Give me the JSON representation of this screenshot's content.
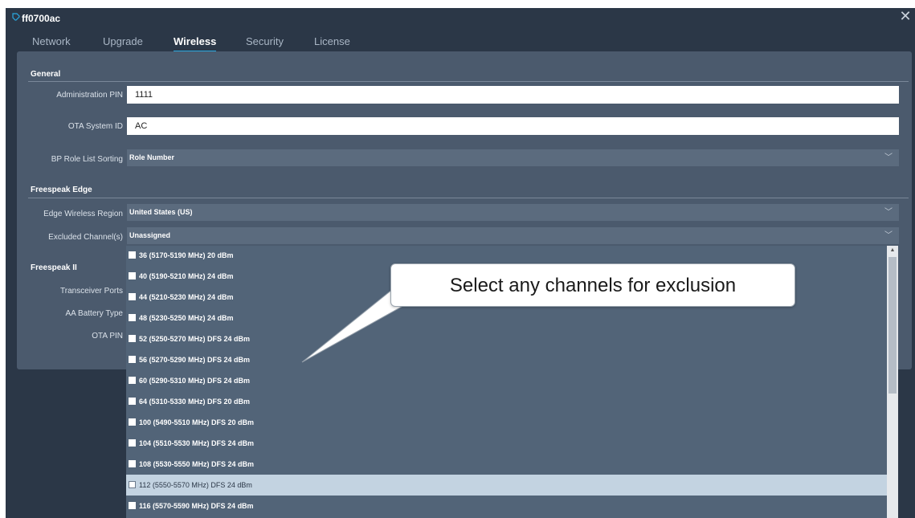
{
  "window": {
    "title": "ff0700ac",
    "title_icon": "tag-icon",
    "close_icon": "close-icon"
  },
  "tabs": [
    {
      "label": "Network",
      "active": false
    },
    {
      "label": "Upgrade",
      "active": false
    },
    {
      "label": "Wireless",
      "active": true
    },
    {
      "label": "Security",
      "active": false
    },
    {
      "label": "License",
      "active": false
    }
  ],
  "general": {
    "title": "General",
    "admin_pin": {
      "label": "Administration PIN",
      "value": "1111"
    },
    "ota_system_id": {
      "label": "OTA System ID",
      "value": "AC"
    },
    "bp_role_sort": {
      "label": "BP Role List Sorting",
      "value": "Role Number"
    }
  },
  "freespeak_edge": {
    "title": "Freespeak Edge",
    "region": {
      "label": "Edge Wireless Region",
      "value": "United States (US)"
    },
    "excluded": {
      "label": "Excluded Channel(s)",
      "value": "Unassigned"
    }
  },
  "freespeak_ii": {
    "title": "Freespeak II",
    "transceiver_ports": {
      "label": "Transceiver Ports"
    },
    "battery_type": {
      "label": "AA Battery Type"
    },
    "ota_pin": {
      "label": "OTA PIN"
    }
  },
  "channel_options": [
    {
      "label": "36 (5170-5190 MHz) 20 dBm",
      "highlighted": false
    },
    {
      "label": "40 (5190-5210 MHz) 24 dBm",
      "highlighted": false
    },
    {
      "label": "44 (5210-5230 MHz) 24 dBm",
      "highlighted": false
    },
    {
      "label": "48 (5230-5250 MHz) 24 dBm",
      "highlighted": false
    },
    {
      "label": "52 (5250-5270 MHz) DFS 24 dBm",
      "highlighted": false
    },
    {
      "label": "56 (5270-5290 MHz) DFS 24 dBm",
      "highlighted": false
    },
    {
      "label": "60 (5290-5310 MHz) DFS 24 dBm",
      "highlighted": false
    },
    {
      "label": "64 (5310-5330 MHz) DFS 20 dBm",
      "highlighted": false
    },
    {
      "label": "100 (5490-5510 MHz) DFS 20 dBm",
      "highlighted": false
    },
    {
      "label": "104 (5510-5530 MHz) DFS 24 dBm",
      "highlighted": false
    },
    {
      "label": "108 (5530-5550 MHz) DFS 24 dBm",
      "highlighted": false
    },
    {
      "label": "112 (5550-5570 MHz) DFS 24 dBm",
      "highlighted": true
    },
    {
      "label": "116 (5570-5590 MHz) DFS 24 dBm",
      "highlighted": false
    }
  ],
  "callout": {
    "text": "Select any channels for exclusion"
  },
  "colors": {
    "background": "#2b3747",
    "panel": "#4b5a6d",
    "accent": "#2aa8e0",
    "dropdown": "#526478",
    "highlight": "#c3d3e1"
  }
}
